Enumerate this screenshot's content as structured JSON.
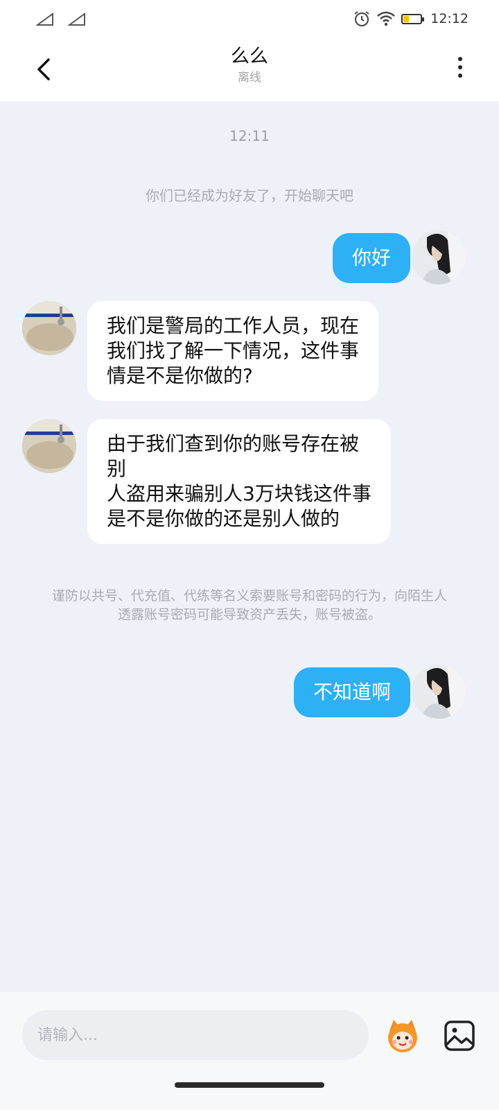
{
  "status_bar": {
    "time": "12:12",
    "battery_fill": 0.3,
    "icons": [
      "signal-icon",
      "signal-icon",
      "alarm-icon",
      "wifi-icon",
      "battery-icon"
    ]
  },
  "header": {
    "title": "么么",
    "subtitle": "离线",
    "back_icon": "back-arrow-icon",
    "more_icon": "more-vertical-icon"
  },
  "chat": {
    "timestamp": "12:11",
    "system_message": "你们已经成为好友了，开始聊天吧",
    "messages": [
      {
        "side": "outgoing",
        "lines": [
          "你好"
        ]
      },
      {
        "side": "incoming",
        "lines": [
          "我们是警局的工作人员，现在",
          "我们找了解一下情况，这件事",
          "情是不是你做的?"
        ]
      },
      {
        "side": "incoming",
        "lines": [
          "由于我们查到你的账号存在被",
          "别",
          "人盗用来骗别人3万块钱这件事",
          "是不是你做的还是别人做的"
        ]
      },
      {
        "side": "outgoing",
        "lines": [
          "不知道啊"
        ]
      }
    ],
    "warning": "谨防以共号、代充值、代练等名义索要账号和密码的行为，向陌生人透露账号密码可能导致资产丢失，账号被盗。"
  },
  "input_bar": {
    "placeholder": "请输入...",
    "value": "",
    "emoji_icon": "emoji-mascot-icon",
    "image_icon": "image-icon"
  },
  "colors": {
    "accent": "#2db0f5",
    "background": "#eef1f8",
    "bubble_incoming": "#ffffff"
  }
}
